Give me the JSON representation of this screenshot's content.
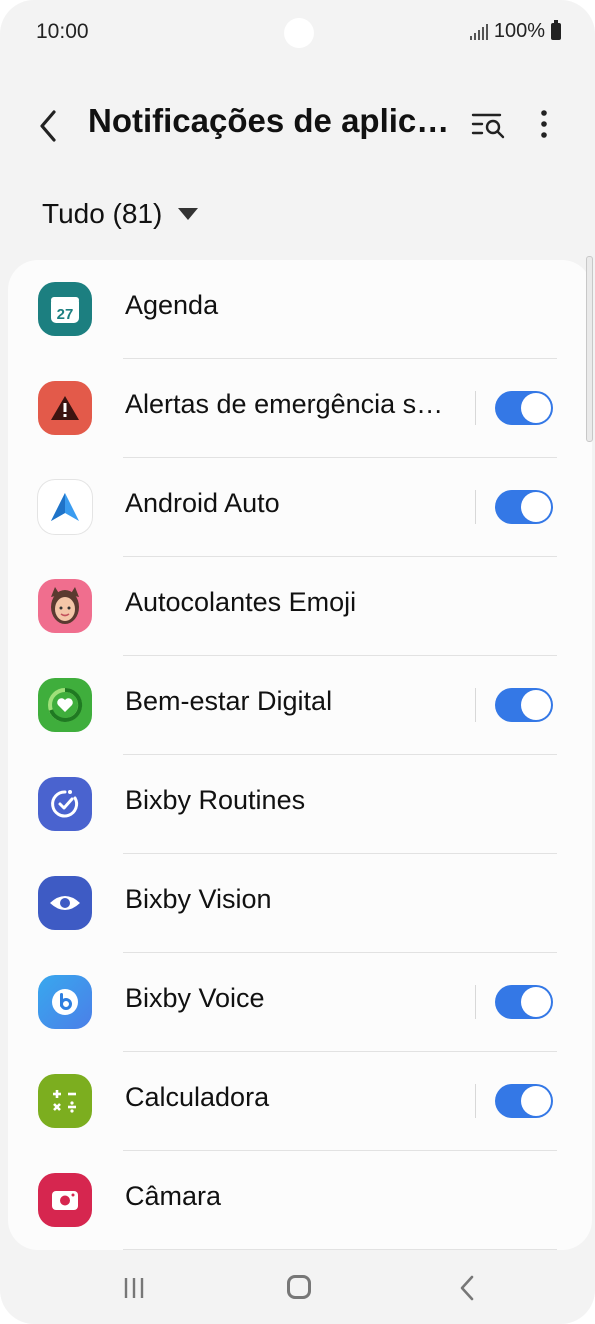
{
  "status_bar": {
    "time": "10:00",
    "battery": "100%"
  },
  "header": {
    "title": "Notificações de aplic…"
  },
  "filter": {
    "label": "Tudo (81)"
  },
  "apps": [
    {
      "label": "Agenda",
      "icon": "calendar-icon",
      "toggle": null,
      "calendar_day": "27"
    },
    {
      "label": "Alertas de emergência s…",
      "icon": "emergency-alert-icon",
      "toggle": true
    },
    {
      "label": "Android Auto",
      "icon": "android-auto-icon",
      "toggle": true
    },
    {
      "label": "Autocolantes Emoji",
      "icon": "ar-emoji-icon",
      "toggle": null
    },
    {
      "label": "Bem-estar Digital",
      "icon": "digital-wellbeing-icon",
      "toggle": true
    },
    {
      "label": "Bixby Routines",
      "icon": "bixby-routines-icon",
      "toggle": null
    },
    {
      "label": "Bixby Vision",
      "icon": "bixby-vision-icon",
      "toggle": null
    },
    {
      "label": "Bixby Voice",
      "icon": "bixby-voice-icon",
      "toggle": true
    },
    {
      "label": "Calculadora",
      "icon": "calculator-icon",
      "toggle": true
    },
    {
      "label": "Câmara",
      "icon": "camera-icon",
      "toggle": null
    }
  ],
  "colors": {
    "accent": "#3478e6",
    "background": "#f3f3f3",
    "card": "#fcfcfc"
  }
}
